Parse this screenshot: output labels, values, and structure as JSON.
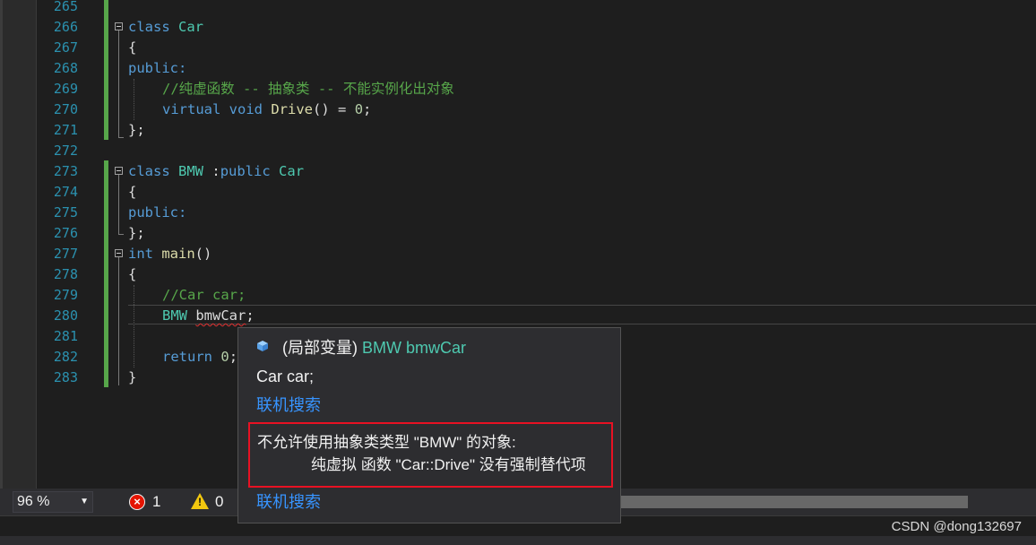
{
  "editor": {
    "line_numbers": [
      "265",
      "266",
      "267",
      "268",
      "269",
      "270",
      "271",
      "272",
      "273",
      "274",
      "275",
      "276",
      "277",
      "278",
      "279",
      "280",
      "281",
      "282",
      "283"
    ],
    "lines": {
      "l266": {
        "kw": "class",
        "name": "Car"
      },
      "l267": "{",
      "l268": "public:",
      "l269": "//纯虚函数 -- 抽象类 -- 不能实例化出对象",
      "l270": {
        "kw1": "virtual",
        "kw2": "void",
        "fn": "Drive",
        "rest1": "() = ",
        "num": "0",
        "rest2": ";"
      },
      "l271": "};",
      "l273": {
        "kw": "class",
        "name": "BMW",
        "mid": " :",
        "kw2": "public",
        "base": "Car"
      },
      "l274": "{",
      "l275": "public:",
      "l276": "};",
      "l277": {
        "kw": "int",
        "fn": "main",
        "rest": "()"
      },
      "l278": "{",
      "l279": "//Car car;",
      "l280": {
        "type": "BMW",
        "var": "bmwCar",
        "rest": ";"
      },
      "l282": {
        "kw": "return",
        "num": "0",
        "rest": ";"
      },
      "l283": "}"
    }
  },
  "tooltip": {
    "icon": "local-variable-cube-icon",
    "header_prefix": "(局部变量)",
    "header_type": "BMW",
    "header_name": "bmwCar",
    "code_preview": "Car car;",
    "online_search_1": "联机搜索",
    "error_line1": "不允许使用抽象类类型 \"BMW\" 的对象:",
    "error_line2": "纯虚拟 函数 \"Car::Drive\" 没有强制替代项",
    "online_search_2": "联机搜索"
  },
  "statusbar": {
    "zoom": "96 %",
    "error_count": "1",
    "warning_count": "0"
  },
  "watermark": "CSDN @dong132697",
  "colors": {
    "background": "#1e1e1e",
    "keyword": "#569cd6",
    "type": "#4ec9b0",
    "function": "#dcdcaa",
    "comment": "#57a64a",
    "line_number": "#2b91af",
    "link": "#3794ff",
    "error_border": "#e81123"
  }
}
